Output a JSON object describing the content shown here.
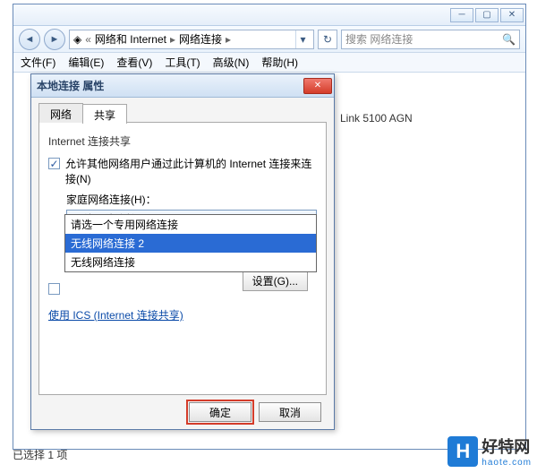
{
  "explorer": {
    "breadcrumb": {
      "part1": "网络和 Internet",
      "part2": "网络连接"
    },
    "search_placeholder": "搜索 网络连接",
    "menus": {
      "file": "文件(F)",
      "edit": "编辑(E)",
      "view": "查看(V)",
      "tools": "工具(T)",
      "advanced": "高级(N)",
      "help": "帮助(H)"
    },
    "right_text": "Link 5100 AGN",
    "status": "已选择 1 项"
  },
  "dialog": {
    "title": "本地连接 属性",
    "tabs": {
      "network": "网络",
      "share": "共享"
    },
    "group": "Internet 连接共享",
    "allow_label": "允许其他网络用户通过此计算机的 Internet 连接来连接(N)",
    "home_label": "家庭网络连接(H)：",
    "combo_value": "无线网络连接 2",
    "dropdown": {
      "hint": "请选一个专用网络连接",
      "opt_selected": "无线网络连接 2",
      "opt_other": "无线网络连接"
    },
    "link": "使用 ICS (Internet 连接共享)",
    "settings_btn": "设置(G)...",
    "ok": "确定",
    "cancel": "取消"
  },
  "logo": {
    "badge": "H",
    "name": "好特网",
    "url": "haote.com"
  }
}
